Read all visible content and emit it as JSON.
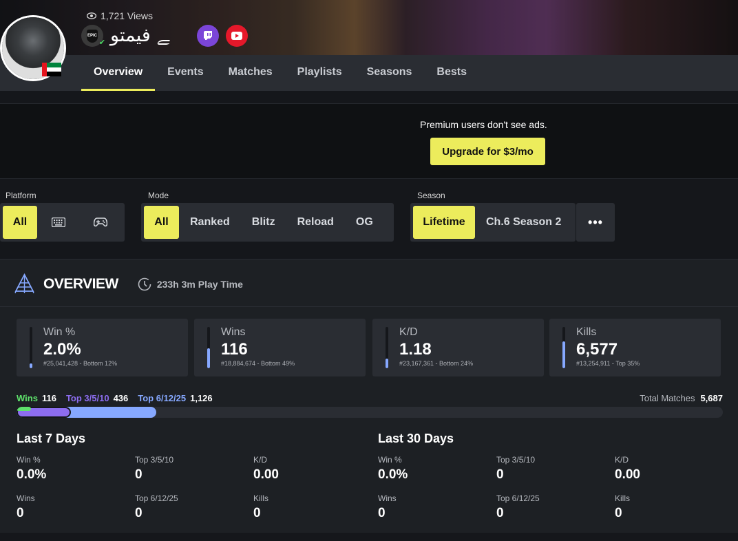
{
  "profile": {
    "views": "1,721 Views",
    "name": "ﮯ فيمتو",
    "platform_icon": "epic-games-icon",
    "verified_icon": "check-icon",
    "flag": "uae-flag",
    "social": [
      {
        "name": "twitch-icon",
        "color": "#7b45d8"
      },
      {
        "name": "youtube-icon",
        "color": "#e5182a"
      }
    ]
  },
  "nav": {
    "tabs": [
      "Overview",
      "Events",
      "Matches",
      "Playlists",
      "Seasons",
      "Bests"
    ],
    "active": "Overview"
  },
  "ad": {
    "text": "Premium users don't see ads.",
    "button": "Upgrade for $3/mo"
  },
  "filters": {
    "platform": {
      "label": "Platform",
      "options": [
        "All",
        "keyboard-icon",
        "gamepad-icon"
      ],
      "selected": "All"
    },
    "mode": {
      "label": "Mode",
      "options": [
        "All",
        "Ranked",
        "Blitz",
        "Reload",
        "OG"
      ],
      "selected": "All"
    },
    "season": {
      "label": "Season",
      "options": [
        "Lifetime",
        "Ch.6 Season 2"
      ],
      "selected": "Lifetime",
      "more_icon": "more-icon"
    }
  },
  "overview": {
    "title": "OVERVIEW",
    "playtime": "233h 3m Play Time",
    "cards": [
      {
        "label": "Win %",
        "value": "2.0%",
        "rank": "#25,041,428 - Bottom 12%",
        "level": 0.12
      },
      {
        "label": "Wins",
        "value": "116",
        "rank": "#18,884,674 - Bottom 49%",
        "level": 0.49
      },
      {
        "label": "K/D",
        "value": "1.18",
        "rank": "#23,167,361 - Bottom 24%",
        "level": 0.24
      },
      {
        "label": "Kills",
        "value": "6,577",
        "rank": "#13,254,911 - Top 35%",
        "level": 0.65
      }
    ],
    "progress": {
      "wins_label": "Wins",
      "wins": "116",
      "top1_label": "Top 3/5/10",
      "top1": "436",
      "top2_label": "Top 6/12/25",
      "top2": "1,126",
      "total_label": "Total Matches",
      "total": "5,687",
      "fractions": {
        "wins": 0.0204,
        "top1": 0.0767,
        "top2": 0.198
      },
      "colors": {
        "wins": "#5ee16b",
        "top1": "#8d6df0",
        "top2": "#86a8ff"
      }
    },
    "periods": [
      {
        "title": "Last 7 Days",
        "stats": [
          {
            "label": "Win %",
            "value": "0.0%"
          },
          {
            "label": "Top 3/5/10",
            "value": "0"
          },
          {
            "label": "K/D",
            "value": "0.00"
          },
          {
            "label": "Wins",
            "value": "0"
          },
          {
            "label": "Top 6/12/25",
            "value": "0"
          },
          {
            "label": "Kills",
            "value": "0"
          }
        ]
      },
      {
        "title": "Last 30 Days",
        "stats": [
          {
            "label": "Win %",
            "value": "0.0%"
          },
          {
            "label": "Top 3/5/10",
            "value": "0"
          },
          {
            "label": "K/D",
            "value": "0.00"
          },
          {
            "label": "Wins",
            "value": "0"
          },
          {
            "label": "Top 6/12/25",
            "value": "0"
          },
          {
            "label": "Kills",
            "value": "0"
          }
        ]
      }
    ]
  },
  "colors": {
    "accent": "#ecec5c"
  }
}
